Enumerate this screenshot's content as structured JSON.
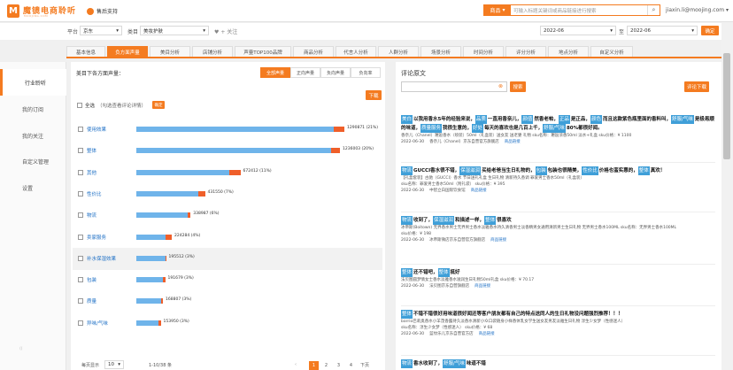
{
  "brand": {
    "logo_letter": "M",
    "name": "魔镜电商聆听",
    "sub": "MOOJING.COM"
  },
  "support": {
    "label": "售后支持"
  },
  "search": {
    "scope": "商品",
    "placeholder": "可输入标题关键词或商品链接进行搜索"
  },
  "user": {
    "email": "jiaxin.li@moojing.com"
  },
  "filters": {
    "platform_label": "平台",
    "platform_value": "京东",
    "category_label": "类目",
    "category_value": "美妆护肤",
    "focus_label": "+ 关注",
    "date_start": "2022-06",
    "date_sep": "至",
    "date_end": "2022-06",
    "apply": "确定"
  },
  "sidebar": {
    "items": [
      {
        "label": "行业聆听"
      },
      {
        "label": "我的订阅"
      },
      {
        "label": "我的关注"
      },
      {
        "label": "自定义管理"
      },
      {
        "label": "设置"
      }
    ]
  },
  "tabs": [
    {
      "label": "基本信息"
    },
    {
      "label": "负方面声量"
    },
    {
      "label": "美目分析"
    },
    {
      "label": "店铺分析"
    },
    {
      "label": "声量TOP100品牌"
    },
    {
      "label": "商品分析"
    },
    {
      "label": "代言人分析"
    },
    {
      "label": "人群分析"
    },
    {
      "label": "场景分析"
    },
    {
      "label": "时间分析"
    },
    {
      "label": "评分分析"
    },
    {
      "label": "地点分析"
    },
    {
      "label": "自定义分析"
    }
  ],
  "left": {
    "title": "美目下各方面声量：",
    "segments": [
      {
        "label": "全部声量"
      },
      {
        "label": "正向声量"
      },
      {
        "label": "负向声量"
      },
      {
        "label": "负向率"
      }
    ],
    "download": "下载",
    "select_all": "全选",
    "select_hint": "（勾选查看评论详情）",
    "confirm": "确定",
    "rows": [
      {
        "name": "使用效果",
        "value": "1290871 (21%)",
        "pos": 0.89,
        "neg": 0.05
      },
      {
        "name": "整体",
        "value": "1236003 (20%)",
        "pos": 0.88,
        "neg": 0.04
      },
      {
        "name": "其他",
        "value": "672412 (11%)",
        "pos": 0.42,
        "neg": 0.05
      },
      {
        "name": "性价比",
        "value": "431550 (7%)",
        "pos": 0.28,
        "neg": 0.03
      },
      {
        "name": "物流",
        "value": "338987 (6%)",
        "pos": 0.23,
        "neg": 0.015
      },
      {
        "name": "卖家服务",
        "value": "224284 (4%)",
        "pos": 0.13,
        "neg": 0.03
      },
      {
        "name": "补水保湿效果",
        "value": "195512 (3%)",
        "pos": 0.13,
        "neg": 0.003
      },
      {
        "name": "包装",
        "value": "191679 (3%)",
        "pos": 0.12,
        "neg": 0.01
      },
      {
        "name": "质量",
        "value": "168807 (3%)",
        "pos": 0.11,
        "neg": 0.01
      },
      {
        "name": "异味/气味",
        "value": "153950 (3%)",
        "pos": 0.1,
        "neg": 0.01
      }
    ],
    "pager": {
      "size_label": "每页显示",
      "size": "10",
      "range": "1-10/38 条",
      "pages": [
        "1",
        "2",
        "3",
        "4"
      ],
      "next": "下页"
    }
  },
  "right": {
    "title": "评论原文",
    "search_btn": "搜索",
    "export": "评论下载",
    "reviews": [
      {
        "segments": [
          {
            "t": "美白",
            "tag": true
          },
          {
            "t": "以我用香水5年的经验来说，"
          },
          {
            "t": "品质",
            "tag": true
          },
          {
            "t": "一直用香奈儿，"
          },
          {
            "t": "颜值",
            "tag": true
          },
          {
            "t": "然香老帕，"
          },
          {
            "t": "正品",
            "tag": true
          },
          {
            "t": "是正品，"
          },
          {
            "t": "颜色",
            "tag": true
          },
          {
            "t": "而且这款紫色瓶里面的香料叫，"
          },
          {
            "t": "舒服/气味",
            "tag": true
          },
          {
            "t": "是极易顺的味道，"
          },
          {
            "t": "质量服务",
            "tag": true
          },
          {
            "t": "我很生意的，"
          },
          {
            "t": "好处",
            "tag": true
          },
          {
            "t": "每天的喜欢也是几百上千，"
          },
          {
            "t": "舒服/气味",
            "tag": true
          },
          {
            "t": "80%都很好闻。"
          }
        ],
        "meta": "香奈儿（Chanel）邂逅香水（喷装）50ml（礼盒装）送女友 送老婆 礼物   sku名称：邂逅浓香50ml 淡水+礼盒   sku价格：¥ 1100",
        "date": "2022-06-30",
        "shop": "香奈儿（Chanel）京东自营官方旗舰店",
        "link": "商品链接"
      },
      {
        "segments": [
          {
            "t": "物流",
            "tag": true
          },
          {
            "t": "GUCCI香水很不错，"
          },
          {
            "t": "保湿滋润",
            "tag": true
          },
          {
            "t": "买给老爸当生日礼物的，"
          },
          {
            "t": "包装",
            "tag": true
          },
          {
            "t": "包装也很精美，"
          },
          {
            "t": "性价比",
            "tag": true
          },
          {
            "t": "价格也蛮实惠的，"
          },
          {
            "t": "整体",
            "tag": true
          },
          {
            "t": "真欢！"
          }
        ],
        "meta": "【礼盒套装】古驰（GUCCI）香水 节日送礼礼盒 生日礼物 清新持久香调 罪爱男士香水50ml（礼盒装）",
        "meta2": "sku名称：罪爱男士香水50ml（附礼袋）  sku价格：¥ 395",
        "date": "2022-06-30",
        "shop": "中智立白国际饮食馆",
        "link": "商品链接"
      },
      {
        "segments": [
          {
            "t": "物流",
            "tag": true
          },
          {
            "t": "收到了，"
          },
          {
            "t": "保湿滋润",
            "tag": true
          },
          {
            "t": "和描述一样，"
          },
          {
            "t": "整体",
            "tag": true
          },
          {
            "t": "很喜欢"
          }
        ],
        "meta": "冰帝斯(Boitown)  无界香水男士无界男士香水淡雅香水持久清香男士淡香精男女通用清新男士生日礼物 无界男士香水100ML  sku名称：无界男士香水100ML",
        "meta2": "sku价格：¥ 198",
        "date": "2022-06-30",
        "shop": "冰帝斯微店京东自营官方旗舰店",
        "link": "商品链接"
      },
      {
        "segments": [
          {
            "t": "整体",
            "tag": true
          },
          {
            "t": "还不错吧，"
          },
          {
            "t": "整体",
            "tag": true
          },
          {
            "t": "挺好"
          }
        ],
        "meta": "法贝图圆梦情女士香水淡雅香水滋润生日礼物50ml礼盒  sku价格：¥ 70.17",
        "date": "2022-06-30",
        "shop": "法贝图京东自营旗舰店",
        "link": "商品链接"
      },
      {
        "segments": [
          {
            "t": "整体",
            "tag": true
          },
          {
            "t": "不错不错很好用味道很好闻还等客户朋友都有自己的特点送同人的生日礼物没问题强烈推荐！！！"
          }
        ],
        "meta": "barrio巴莉奥香水小羊茂香露持久淡香水清新小众口袋随身小样香体乳女学生送女友男友淡雅生日礼物 淳生少女梦（性感迷人）",
        "meta2": "sku名称：淳生少女梦（性感迷人） sku价格：¥ 68",
        "date": "2022-06-30",
        "shop": "蓝纹乐儿京东自营官方店",
        "link": "商品链接"
      },
      {
        "segments": [
          {
            "t": "物流",
            "tag": true
          },
          {
            "t": "香水收到了，"
          },
          {
            "t": "舒服/气味",
            "tag": true
          },
          {
            "t": "味道不错"
          }
        ]
      }
    ]
  },
  "colors": {
    "accent": "#f47b20",
    "positive": "#6fb4ea",
    "negative": "#ef5f2a",
    "tag": "#3f9fd8",
    "link": "#1d6fc5"
  }
}
